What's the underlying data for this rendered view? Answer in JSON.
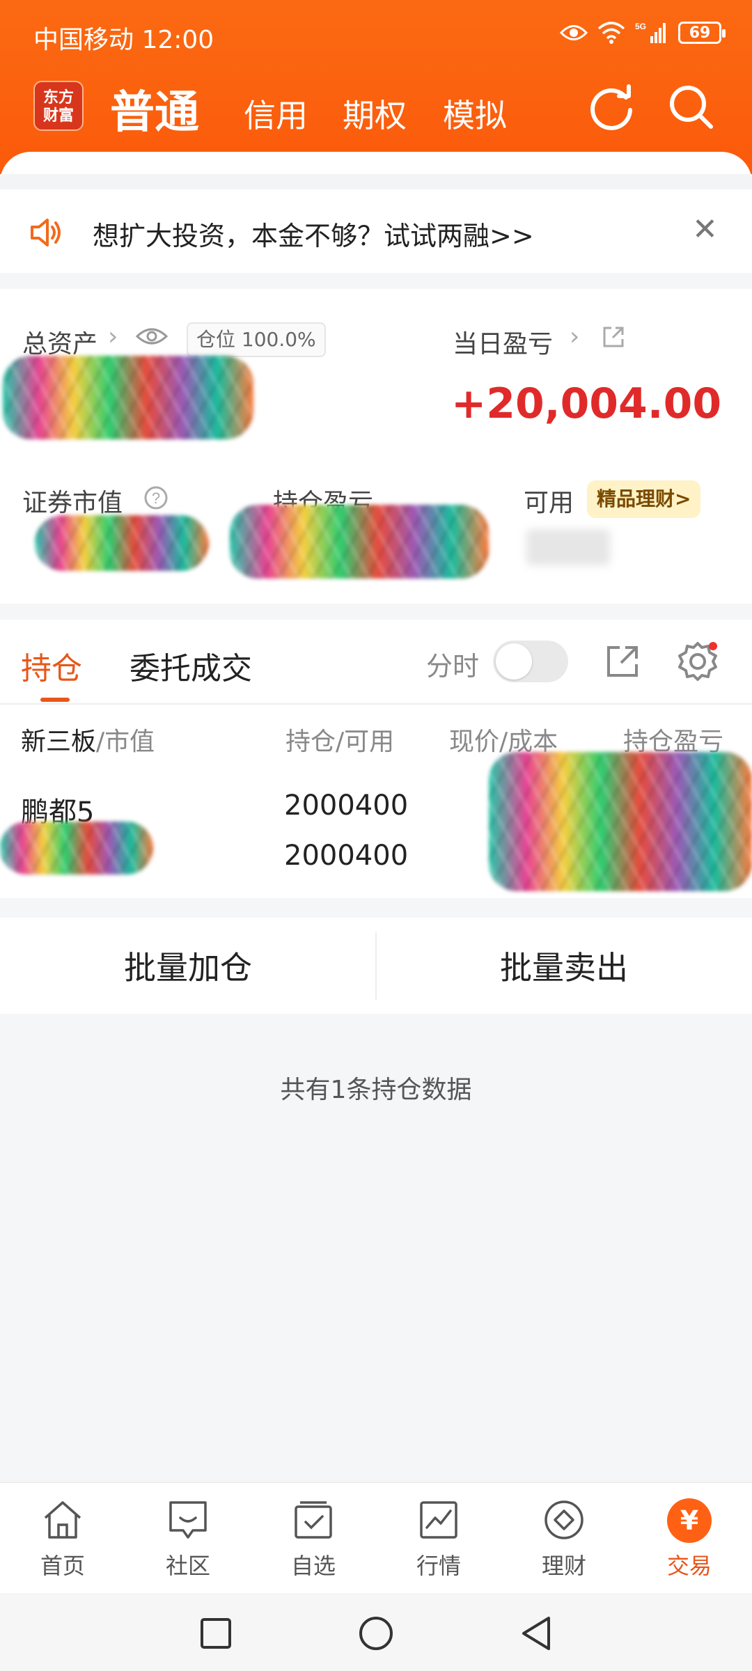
{
  "status_bar": {
    "carrier_time": "中国移动 12:00",
    "network": "5G",
    "battery": "69"
  },
  "header": {
    "logo_text": "东方\n财富",
    "tabs": [
      "普通",
      "信用",
      "期权",
      "模拟"
    ],
    "active_tab": "普通"
  },
  "banner": {
    "text": "想扩大投资，本金不够？试试两融>>"
  },
  "assets": {
    "total_assets_label": "总资产",
    "position_chip": "仓位 100.0%",
    "daily_pnl_label": "当日盈亏",
    "daily_pnl_value": "+20,004.00",
    "securities_value_label": "证券市值",
    "holding_pnl_label": "持仓盈亏",
    "available_label": "可用",
    "licai_chip": "精品理财>"
  },
  "positions": {
    "tabs": [
      "持仓",
      "委托成交"
    ],
    "fenshi_label": "分时",
    "columns": {
      "c1_strong": "新三板",
      "c1_rest": "/市值",
      "c2": "持仓/可用",
      "c3": "现价/成本",
      "c4": "持仓盈亏"
    },
    "rows": [
      {
        "name": "鹏都5",
        "qty": "2000400",
        "avail": "2000400"
      }
    ],
    "batch_add": "批量加仓",
    "batch_sell": "批量卖出",
    "count_text": "共有1条持仓数据"
  },
  "tabbar": {
    "items": [
      "首页",
      "社区",
      "自选",
      "行情",
      "理财",
      "交易"
    ],
    "yuan_symbol": "¥",
    "accent": "#e8561a"
  }
}
